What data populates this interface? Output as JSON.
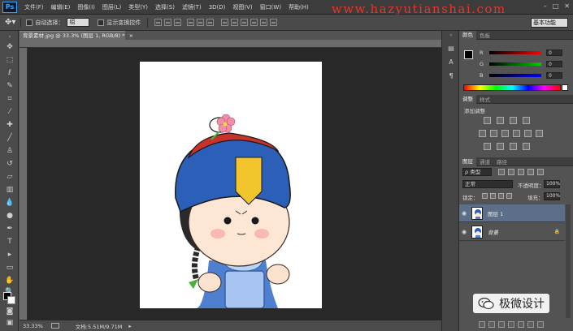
{
  "app": {
    "logo": "Ps"
  },
  "menu": [
    "文件(F)",
    "编辑(E)",
    "图像(I)",
    "图层(L)",
    "类型(Y)",
    "选择(S)",
    "滤镜(T)",
    "3D(D)",
    "视图(V)",
    "窗口(W)",
    "帮助(H)"
  ],
  "watermark": "www.hazyutianshai.com",
  "window_controls": [
    "–",
    "□",
    "✕"
  ],
  "options_bar": {
    "auto_select_label": "自动选择：",
    "group_value": "组",
    "show_transform_label": "显示变换控件"
  },
  "workspace": "基本功能",
  "document": {
    "tab_title": "背景素材.jpg @ 33.3% (图层 1, RGB/8) *",
    "tab_close": "×"
  },
  "status": {
    "zoom": "33.33%",
    "doc_info": "文档:5.51M/9.71M"
  },
  "color_panel": {
    "tabs": [
      "颜色",
      "色板"
    ],
    "channels": [
      {
        "label": "R",
        "value": "0"
      },
      {
        "label": "G",
        "value": "0"
      },
      {
        "label": "B",
        "value": "0"
      }
    ]
  },
  "adjustments_panel": {
    "tabs": [
      "调整",
      "样式"
    ],
    "title": "添加调整"
  },
  "layers_panel": {
    "tabs": [
      "图层",
      "通道",
      "路径"
    ],
    "filter_value": "ρ 类型",
    "blend_mode": "正常",
    "opacity_label": "不透明度：",
    "opacity_value": "100%",
    "lock_label": "锁定：",
    "fill_label": "填充：",
    "fill_value": "100%",
    "layers": [
      {
        "name": "图层 1",
        "selected": true
      },
      {
        "name": "背景",
        "locked": true,
        "lock_icon": "🔒"
      }
    ]
  },
  "wechat_badge": {
    "text": "极微设计"
  },
  "colors": {
    "accent": "#e8362a",
    "selected_layer": "#5d6f88"
  }
}
